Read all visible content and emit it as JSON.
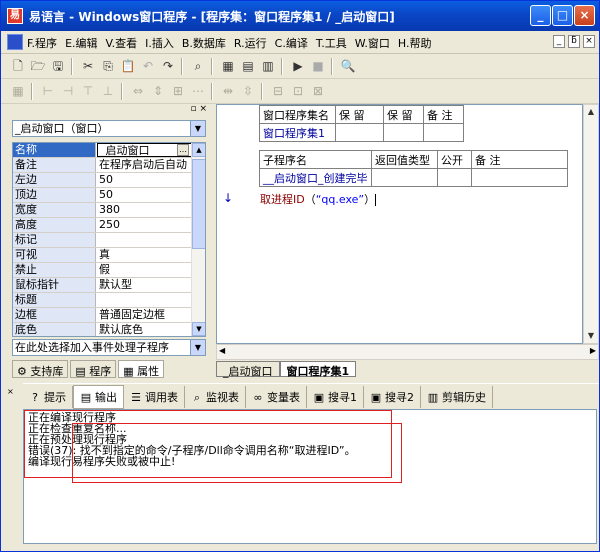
{
  "window": {
    "title": "易语言 - Windows窗口程序 - [程序集：窗口程序集1 / _启动窗口]",
    "minimize": "_",
    "maximize": "□",
    "close": "×"
  },
  "menu": {
    "items": [
      "F.程序",
      "E.编辑",
      "V.查看",
      "I.插入",
      "B.数据库",
      "R.运行",
      "C.编译",
      "T.工具",
      "W.窗口",
      "H.帮助"
    ],
    "mdi_controls": [
      "_",
      "ƃ",
      "×"
    ]
  },
  "left_panel": {
    "object_combo": "_启动窗口（窗口）",
    "properties": [
      {
        "key": "名称",
        "value": "_启动窗口"
      },
      {
        "key": "备注",
        "value": "在程序启动后自动"
      },
      {
        "key": "左边",
        "value": "50"
      },
      {
        "key": "顶边",
        "value": "50"
      },
      {
        "key": "宽度",
        "value": "380"
      },
      {
        "key": "高度",
        "value": "250"
      },
      {
        "key": "标记",
        "value": ""
      },
      {
        "key": "可视",
        "value": "真"
      },
      {
        "key": "禁止",
        "value": "假"
      },
      {
        "key": "鼠标指针",
        "value": "默认型"
      },
      {
        "key": "标题",
        "value": ""
      },
      {
        "key": "边框",
        "value": "普通固定边框"
      },
      {
        "key": "底色",
        "value": "默认底色"
      }
    ],
    "event_combo": "在此处选择加入事件处理子程序",
    "tabs": [
      "支持库",
      "程序",
      "属性"
    ]
  },
  "editor": {
    "assembly_table": {
      "headers": [
        "窗口程序集名",
        "保 留",
        "保 留",
        "备 注"
      ],
      "row": [
        "窗口程序集1",
        "",
        "",
        ""
      ]
    },
    "sub_table": {
      "headers": [
        "子程序名",
        "返回值类型",
        "公开",
        "备 注"
      ],
      "row": [
        "__启动窗口_创建完毕",
        "",
        "",
        ""
      ]
    },
    "code": {
      "fn": "取进程ID",
      "open": "（",
      "str": "“qq.exe”",
      "close": "）"
    },
    "doc_tabs": [
      "_启动窗口",
      "窗口程序集1"
    ]
  },
  "output_panel": {
    "tabs": [
      "提示",
      "输出",
      "调用表",
      "监视表",
      "变量表",
      "搜寻1",
      "搜寻2",
      "剪辑历史"
    ],
    "lines": [
      "正在编译现行程序",
      "正在检查重复名称...",
      "正在预处理现行程序",
      "错误(37): 找不到指定的命令/子程序/Dll命令调用名称“取进程ID”。",
      "编译现行易程序失败或被中止!"
    ]
  },
  "colors": {
    "titlebar": "#0a48c8",
    "error_box": "#e02020",
    "selection": "#316ac5"
  }
}
